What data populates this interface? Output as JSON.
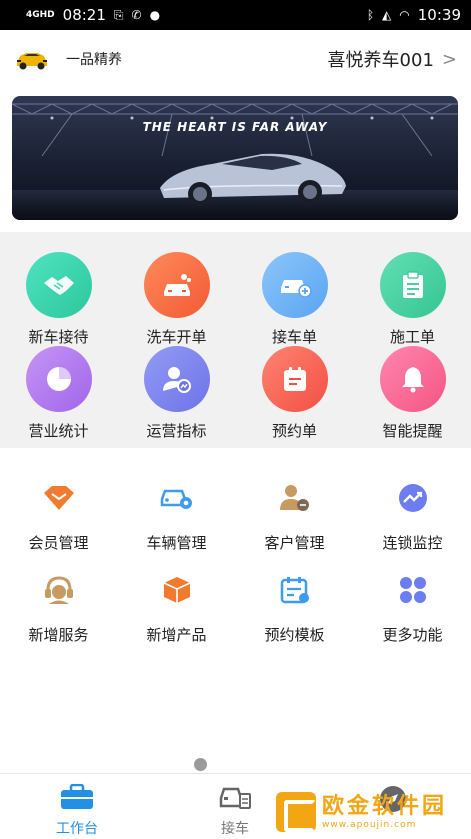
{
  "status_bar": {
    "network": "4GHD",
    "time_left": "08:21",
    "time_right": "10:39"
  },
  "header": {
    "brand": "一品精养",
    "store_name": "喜悦养车001",
    "chevron": ">"
  },
  "banner": {
    "headline": "THE HEART IS FAR AWAY"
  },
  "grid_top": [
    {
      "label": "新车接待",
      "icon": "handshake-icon",
      "color": "#3dd6b0"
    },
    {
      "label": "洗车开单",
      "icon": "car-wash-icon",
      "color": "#ff7043"
    },
    {
      "label": "接车单",
      "icon": "car-add-icon",
      "color": "#6fb3f7"
    },
    {
      "label": "施工单",
      "icon": "clipboard-icon",
      "color": "#49d2a6"
    },
    {
      "label": "营业统计",
      "icon": "pie-chart-icon",
      "color": "#b67cf0"
    },
    {
      "label": "运营指标",
      "icon": "user-chart-icon",
      "color": "#7d85f0"
    },
    {
      "label": "预约单",
      "icon": "calendar-icon",
      "color": "#ff6a5a"
    },
    {
      "label": "智能提醒",
      "icon": "bell-icon",
      "color": "#ff6b9a"
    }
  ],
  "grid_bottom": [
    {
      "label": "会员管理",
      "icon": "vip-diamond-icon",
      "color": "#f07a2e"
    },
    {
      "label": "车辆管理",
      "icon": "car-settings-icon",
      "color": "#3f9bf0"
    },
    {
      "label": "客户管理",
      "icon": "customer-icon",
      "color": "#c79a62"
    },
    {
      "label": "连锁监控",
      "icon": "trend-icon",
      "color": "#6c7df0"
    },
    {
      "label": "新增服务",
      "icon": "headset-icon",
      "color": "#c79a62"
    },
    {
      "label": "新增产品",
      "icon": "box-icon",
      "color": "#f07a2e"
    },
    {
      "label": "预约模板",
      "icon": "calendar-template-icon",
      "color": "#3f9bf0"
    },
    {
      "label": "更多功能",
      "icon": "grid-more-icon",
      "color": "#6c7df0"
    }
  ],
  "tabs": [
    {
      "label": "工作台",
      "icon": "toolbox-icon",
      "active": true
    },
    {
      "label": "接车",
      "icon": "car-receive-icon",
      "active": false
    }
  ],
  "watermark": {
    "brand": "欧金软件园",
    "url": "www.apoujin.com"
  }
}
